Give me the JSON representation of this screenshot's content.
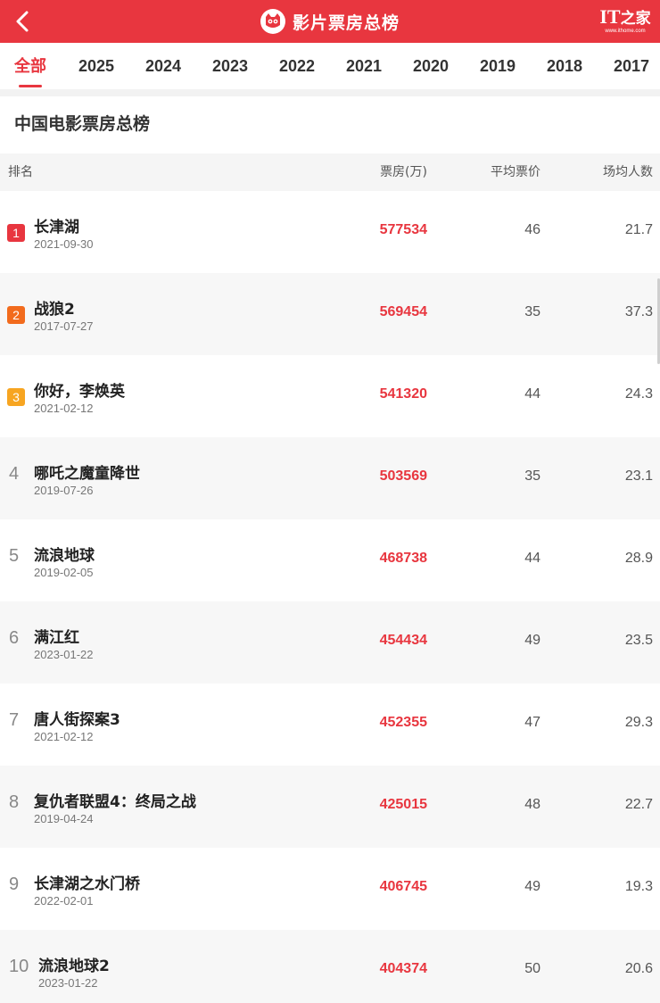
{
  "header": {
    "title": "影片票房总榜",
    "brand": {
      "logo_text": "IT",
      "logo_zh": "之家",
      "url": "www.ithome.com"
    },
    "accent_color": "#e8363f"
  },
  "tabs": [
    {
      "label": "全部",
      "active": true
    },
    {
      "label": "2025",
      "active": false
    },
    {
      "label": "2024",
      "active": false
    },
    {
      "label": "2023",
      "active": false
    },
    {
      "label": "2022",
      "active": false
    },
    {
      "label": "2021",
      "active": false
    },
    {
      "label": "2020",
      "active": false
    },
    {
      "label": "2019",
      "active": false
    },
    {
      "label": "2018",
      "active": false
    },
    {
      "label": "2017",
      "active": false
    }
  ],
  "section": {
    "title": "中国电影票房总榜"
  },
  "table": {
    "columns": {
      "rank": "排名",
      "boxoffice": "票房(万)",
      "avg_price": "平均票价",
      "per_show": "场均人数"
    },
    "rows": [
      {
        "rank": "1",
        "name": "长津湖",
        "date": "2021-09-30",
        "boxoffice": "577534",
        "avg_price": "46",
        "per_show": "21.7"
      },
      {
        "rank": "2",
        "name": "战狼2",
        "date": "2017-07-27",
        "boxoffice": "569454",
        "avg_price": "35",
        "per_show": "37.3"
      },
      {
        "rank": "3",
        "name": "你好，李焕英",
        "date": "2021-02-12",
        "boxoffice": "541320",
        "avg_price": "44",
        "per_show": "24.3"
      },
      {
        "rank": "4",
        "name": "哪吒之魔童降世",
        "date": "2019-07-26",
        "boxoffice": "503569",
        "avg_price": "35",
        "per_show": "23.1"
      },
      {
        "rank": "5",
        "name": "流浪地球",
        "date": "2019-02-05",
        "boxoffice": "468738",
        "avg_price": "44",
        "per_show": "28.9"
      },
      {
        "rank": "6",
        "name": "满江红",
        "date": "2023-01-22",
        "boxoffice": "454434",
        "avg_price": "49",
        "per_show": "23.5"
      },
      {
        "rank": "7",
        "name": "唐人街探案3",
        "date": "2021-02-12",
        "boxoffice": "452355",
        "avg_price": "47",
        "per_show": "29.3"
      },
      {
        "rank": "8",
        "name": "复仇者联盟4：终局之战",
        "date": "2019-04-24",
        "boxoffice": "425015",
        "avg_price": "48",
        "per_show": "22.7"
      },
      {
        "rank": "9",
        "name": "长津湖之水门桥",
        "date": "2022-02-01",
        "boxoffice": "406745",
        "avg_price": "49",
        "per_show": "19.3"
      },
      {
        "rank": "10",
        "name": "流浪地球2",
        "date": "2023-01-22",
        "boxoffice": "404374",
        "avg_price": "50",
        "per_show": "20.6"
      }
    ]
  },
  "rank_badge_colors": {
    "1": "#e8363f",
    "2": "#f26b1d",
    "3": "#f7a521"
  }
}
